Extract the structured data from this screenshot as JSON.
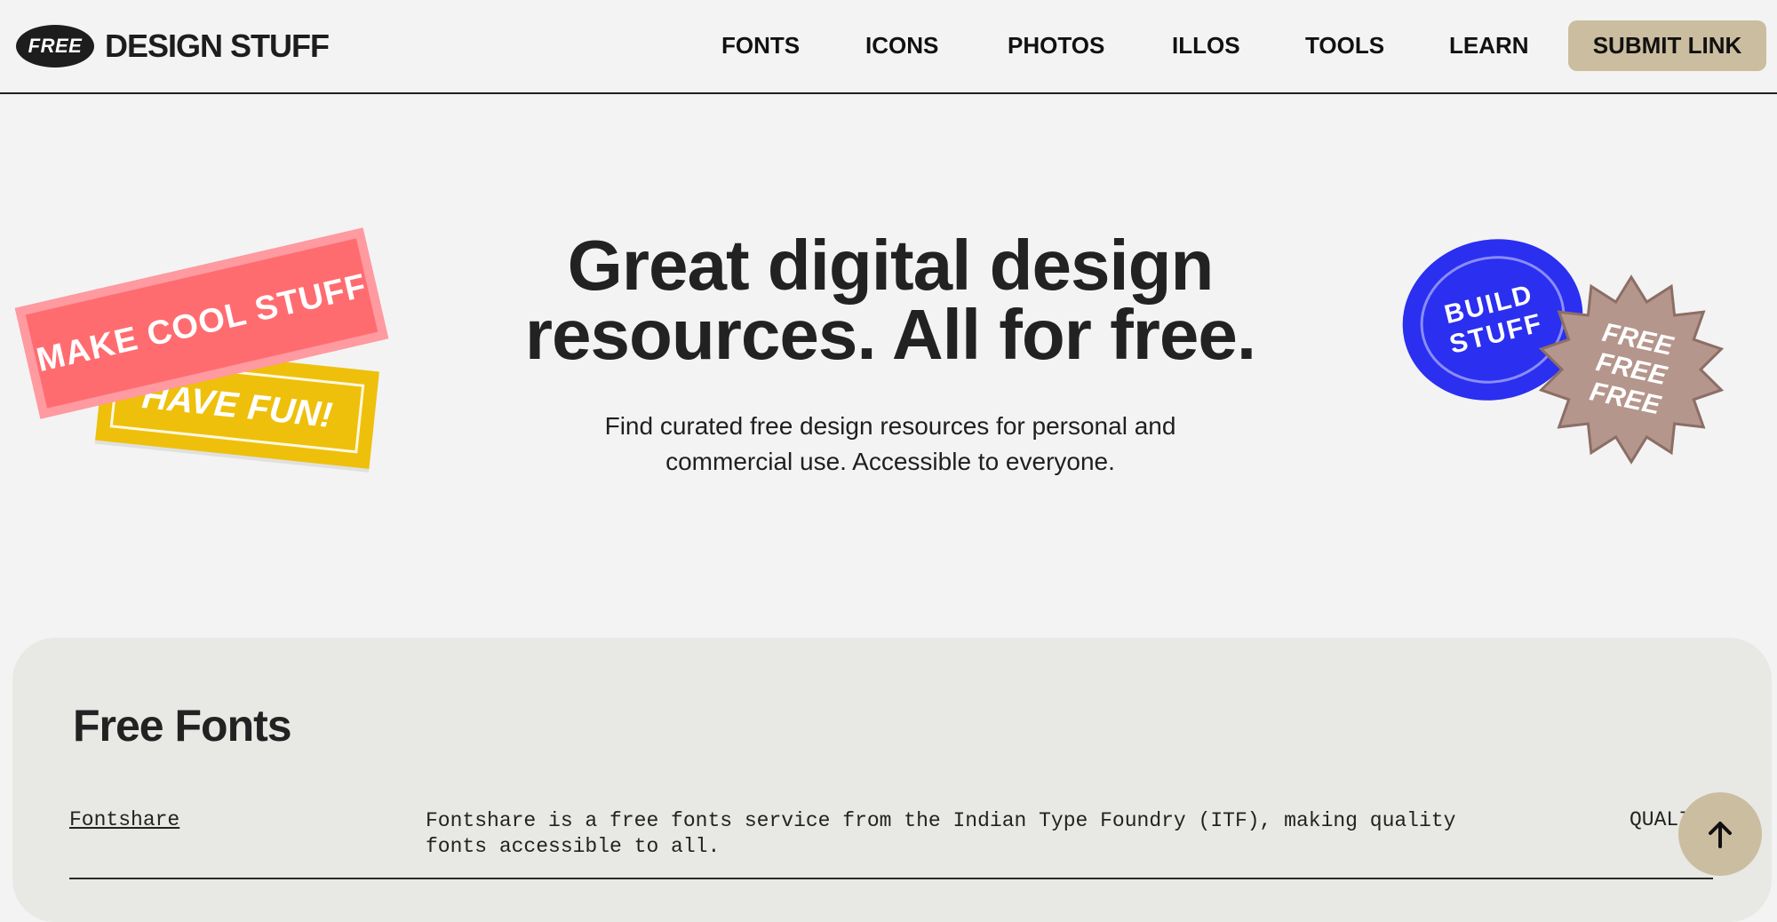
{
  "header": {
    "logo_badge": "FREE",
    "logo_text": "DESIGN STUFF",
    "nav": [
      "FONTS",
      "ICONS",
      "PHOTOS",
      "ILLOS",
      "TOOLS",
      "LEARN"
    ],
    "submit_label": "SUBMIT LINK"
  },
  "hero": {
    "title": "Great digital design resources. All for free.",
    "subtitle": "Find curated free design resources for personal and commercial use. Accessible to everyone."
  },
  "stickers": {
    "red": "MAKE COOL STUFF",
    "yellow": "HAVE FUN!",
    "blue_line1": "BUILD",
    "blue_line2": "STUFF",
    "burst_lines": [
      "FREE",
      "FREE",
      "FREE"
    ]
  },
  "section": {
    "title": "Free Fonts",
    "rows": [
      {
        "name": "Fontshare",
        "description": "Fontshare is a free fonts service from the Indian Type Foundry (ITF), making quality fonts accessible to all.",
        "tag": "QUALI"
      }
    ]
  },
  "icons": {
    "back_to_top": "arrow-up-icon"
  },
  "colors": {
    "background": "#f3f3f3",
    "accent": "#cbbd9f",
    "sticker_red": "#ff6c70",
    "sticker_yellow": "#eec00b",
    "sticker_blue": "#2a2ff0",
    "sticker_burst": "#b5968c",
    "panel": "#e8e8e5"
  }
}
